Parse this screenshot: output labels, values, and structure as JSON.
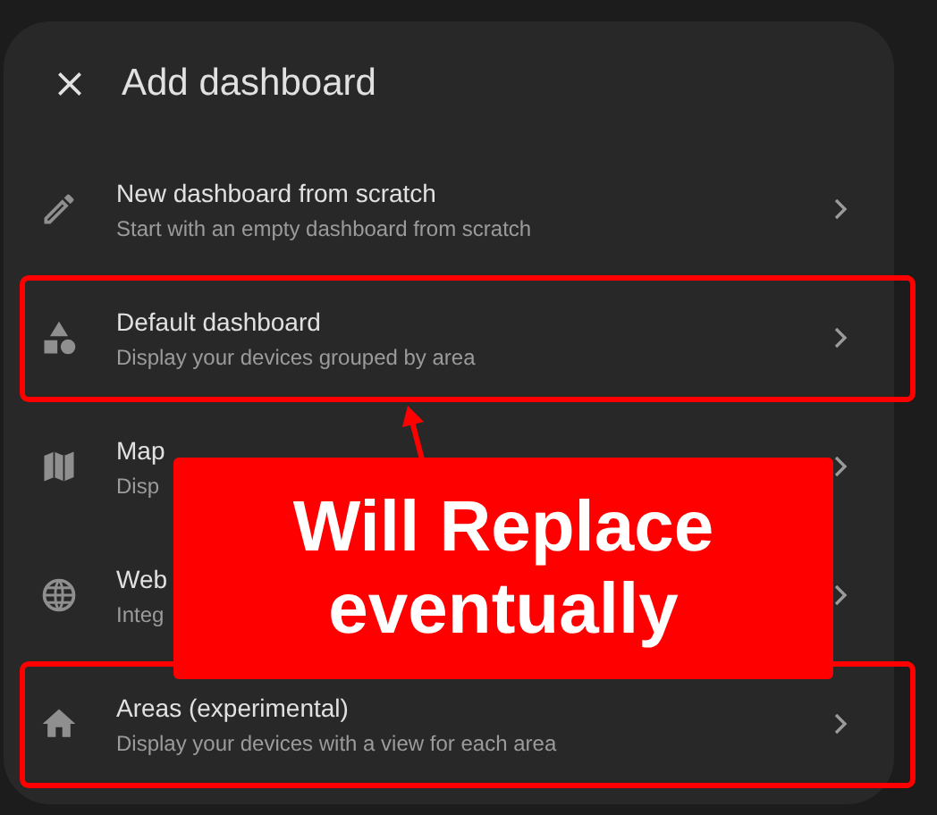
{
  "dialog": {
    "title": "Add dashboard"
  },
  "items": [
    {
      "title": "New dashboard from scratch",
      "subtitle": "Start with an empty dashboard from scratch",
      "annotated": false
    },
    {
      "title": "Default dashboard",
      "subtitle": "Display your devices grouped by area",
      "annotated": true
    },
    {
      "title": "Map",
      "subtitle": "Disp",
      "annotated": false
    },
    {
      "title": "Web",
      "subtitle": "Integ",
      "annotated": false
    },
    {
      "title": "Areas (experimental)",
      "subtitle": "Display your devices with a view for each area",
      "annotated": true
    }
  ],
  "callout": {
    "text": "Will Replace eventually"
  }
}
